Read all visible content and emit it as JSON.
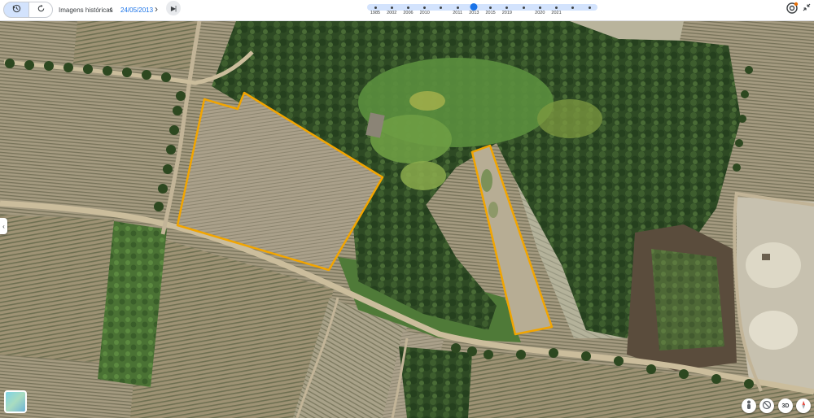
{
  "toolbar": {
    "historical_label": "Imagens históricas",
    "date": "24/05/2013",
    "prev_symbol": "‹",
    "next_symbol": "›",
    "skip_end_symbol": "▶|"
  },
  "timeline": {
    "years": [
      "1985",
      "2002",
      "2006",
      "2010",
      "",
      "2011",
      "2013",
      "2015",
      "2019",
      "",
      "2020",
      "2021",
      "",
      ""
    ],
    "selected_year": "2013"
  },
  "icons": {
    "historical": "history-clock-icon",
    "reset": "reset-rotate-icon",
    "layers": "layers-target-icon",
    "shrink": "collapse-arrows-icon",
    "side_handle": "chevron-left-icon",
    "pegman": "pegman-icon",
    "no_imagery": "hide-imagery-icon",
    "compass": "compass-icon"
  },
  "controls": {
    "threed_label": "3D",
    "side_handle_symbol": "‹"
  },
  "colors": {
    "accent": "#1a73e8",
    "timeline_track": "#d3e3fd",
    "parcel_outline": "#f2a500",
    "road": "#c8b896",
    "tree_dark": "#2f4a22",
    "field": "#a69c80"
  }
}
